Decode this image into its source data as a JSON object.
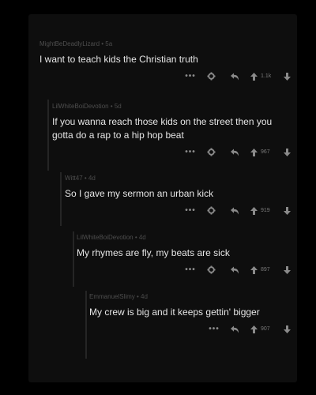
{
  "comments": [
    {
      "user": "MightBeDeadlyLizard",
      "age": "5a",
      "text": "I want to teach kids the Christian truth",
      "score": "1.1k",
      "has_gear": true
    },
    {
      "user": "LilWhiteBoiDevotion",
      "age": "5d",
      "text": "If you wanna reach those kids on the street then you gotta do a rap to a hip hop beat",
      "score": "967",
      "has_gear": true
    },
    {
      "user": "Witt47",
      "age": "4d",
      "text": "So I gave my sermon an urban kick",
      "score": "919",
      "has_gear": true
    },
    {
      "user": "LilWhiteBoiDevotion",
      "age": "4d",
      "text": "My rhymes are fly, my beats are sick",
      "score": "897",
      "has_gear": true
    },
    {
      "user": "EmmanuelSlimy",
      "age": "4d",
      "text": "My crew is big and it keeps gettin' bigger",
      "score": "907",
      "has_gear": false
    }
  ],
  "icons": {
    "more": "more-icon",
    "gear": "gear-icon",
    "reply": "reply-icon",
    "upvote": "upvote-arrow-icon",
    "downvote": "downvote-arrow-icon"
  },
  "ui": {
    "more_glyph": "•••",
    "age_separator": " • "
  },
  "colors": {
    "background": "#000000",
    "panel": "#0e0e0e",
    "text": "#e6e6e6",
    "meta": "#4b4b4b",
    "icons": "#8a8a8a"
  }
}
